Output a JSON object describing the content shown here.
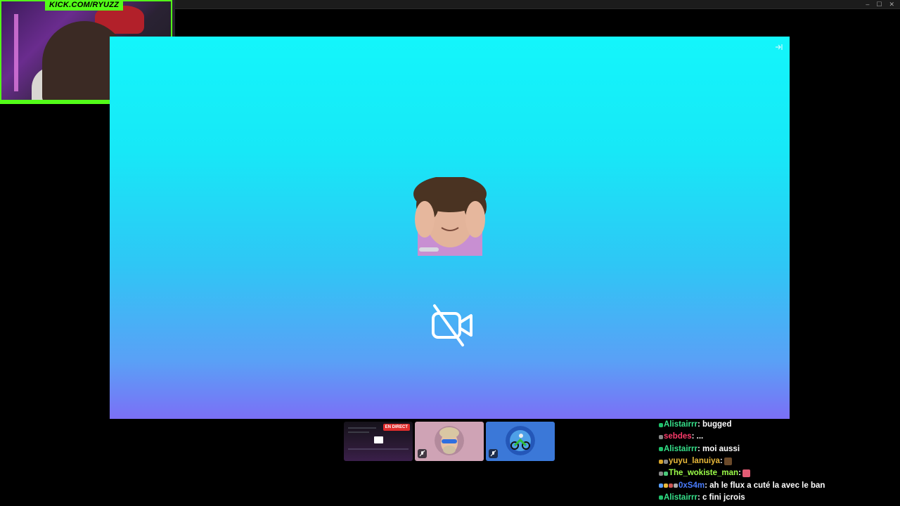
{
  "overlay": {
    "channel_label": "KICK.COM/RYUZZ"
  },
  "window_controls": [
    "–",
    "☐",
    "✕"
  ],
  "live_badge": "EN DIRECT",
  "chat": [
    {
      "user": "Alistairrr",
      "color": "#36e08a",
      "badges": [
        "#1fbf6a"
      ],
      "text": ": bugged"
    },
    {
      "user": "sebdes",
      "color": "#ff3b6b",
      "badges": [
        "#888888"
      ],
      "text": ": ..."
    },
    {
      "user": "Alistairrr",
      "color": "#36e08a",
      "badges": [
        "#1fbf6a"
      ],
      "text": ": moi aussi"
    },
    {
      "user": "yuyu_lanuiya",
      "color": "#e9b93a",
      "badges": [
        "#d6a52a",
        "#888888"
      ],
      "text": ":",
      "emote": "#6b4a2a"
    },
    {
      "user": "The_wokiste_man",
      "color": "#9dff4a",
      "badges": [
        "#888888",
        "#4ac97a"
      ],
      "text": ":",
      "emote": "#e35b74"
    },
    {
      "user": "0xS4m",
      "color": "#4a7dff",
      "badges": [
        "#5aa0ff",
        "#e9b93a",
        "#cc5555",
        "#aaaaaa"
      ],
      "text": ": ah le flux a cuté la avec le ban"
    },
    {
      "user": "Alistairrr",
      "color": "#36e08a",
      "badges": [
        "#1fbf6a"
      ],
      "text": ": c fini jcrois"
    }
  ],
  "colors": {
    "kick_green": "#53fc18",
    "stage_top": "#13f6fb",
    "stage_bottom": "#7b6ff6"
  }
}
